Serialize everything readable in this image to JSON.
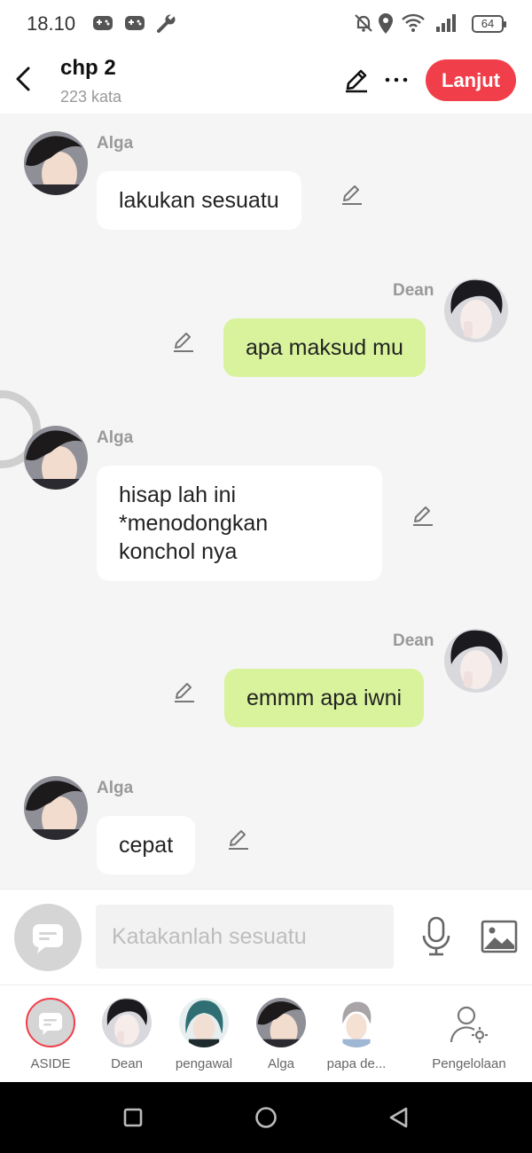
{
  "status_bar": {
    "time": "18.10",
    "battery": "64",
    "icons": [
      "gamepad-icon",
      "gamepad-icon",
      "wrench-icon",
      "bell-off-icon",
      "location-icon",
      "wifi-icon",
      "signal-icon",
      "battery-icon"
    ]
  },
  "header": {
    "title": "chp 2",
    "subtitle": "223 kata",
    "continue_label": "Lanjut",
    "accent_color": "#f03e4a"
  },
  "messages": [
    {
      "sender": "Alga",
      "side": "left",
      "text": "lakukan sesuatu"
    },
    {
      "sender": "Dean",
      "side": "right",
      "text": "apa maksud mu"
    },
    {
      "sender": "Alga",
      "side": "left",
      "lines": [
        "hisap lah ini",
        "*menodongkan",
        "konchol nya"
      ]
    },
    {
      "sender": "Dean",
      "side": "right",
      "text": "emmm apa iwni"
    },
    {
      "sender": "Alga",
      "side": "left",
      "text": "cepat"
    }
  ],
  "bubble_colors": {
    "left": "#ffffff",
    "right": "#d8f39c"
  },
  "composer": {
    "placeholder": "Katakanlah sesuatu"
  },
  "characters": [
    {
      "label": "ASIDE"
    },
    {
      "label": "Dean"
    },
    {
      "label": "pengawal"
    },
    {
      "label": "Alga"
    },
    {
      "label": "papa de..."
    },
    {
      "label": "Pengelolaan"
    }
  ]
}
